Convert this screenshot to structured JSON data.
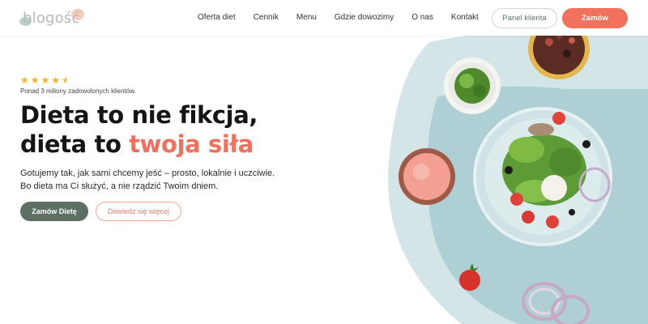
{
  "brand": {
    "logo_text": "blogość"
  },
  "nav": {
    "items": [
      {
        "label": "Oferta diet"
      },
      {
        "label": "Cennik"
      },
      {
        "label": "Menu"
      },
      {
        "label": "Gdzie dowozimy"
      },
      {
        "label": "O nas"
      },
      {
        "label": "Kontakt"
      }
    ]
  },
  "header": {
    "panel_label": "Panel klienta",
    "order_label": "Zamów"
  },
  "hero": {
    "rating": 4.5,
    "rating_text": "Ponad 3 miliony zadowolonych klientów.",
    "title_line1": "Dieta to nie fikcja,",
    "title_line2": "dieta to",
    "title_accent": "twoja siła",
    "desc_line1": "Gotujemy tak, jak sami chcemy jeść – prosto, lokalnie i uczciwie.",
    "desc_line2": "Bo dieta ma Ci służyć, a nie rządzić Twoim dniem.",
    "primary_button": "Zamów Dietę",
    "secondary_button": "Dowiedz się więcej"
  },
  "colors": {
    "accent": "#f2715c",
    "primary_green": "#5d7063",
    "star": "#f4b324",
    "teal_light": "#d2e4e6",
    "teal": "#aed0d5"
  }
}
